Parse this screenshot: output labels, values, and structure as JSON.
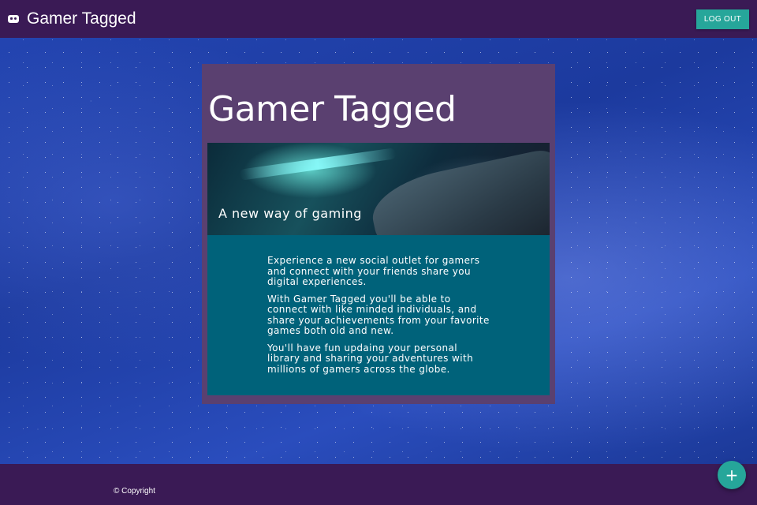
{
  "navbar": {
    "brand_icon": "gamepad-icon",
    "title": "Gamer Tagged",
    "logout_label": "LOG OUT"
  },
  "card": {
    "title": "Gamer Tagged",
    "hero_caption": "A new way of gaming",
    "paragraphs": [
      "Experience a new social outlet for gamers and connect with your friends share you digital experiences.",
      "With Gamer Tagged you'll be able to connect with like minded individuals, and share your achievements from your favorite games both old and new.",
      "You'll have fun updaing your personal library and sharing your adventures with millions of gamers across the globe."
    ]
  },
  "footer": {
    "copyright": "© Copyright"
  },
  "fab": {
    "label": "+",
    "icon": "plus-icon"
  },
  "colors": {
    "nav_bg": "#3a1a55",
    "accent": "#26a69a",
    "card_bg": "#5a4070",
    "card_body_bg": "#00627a"
  }
}
